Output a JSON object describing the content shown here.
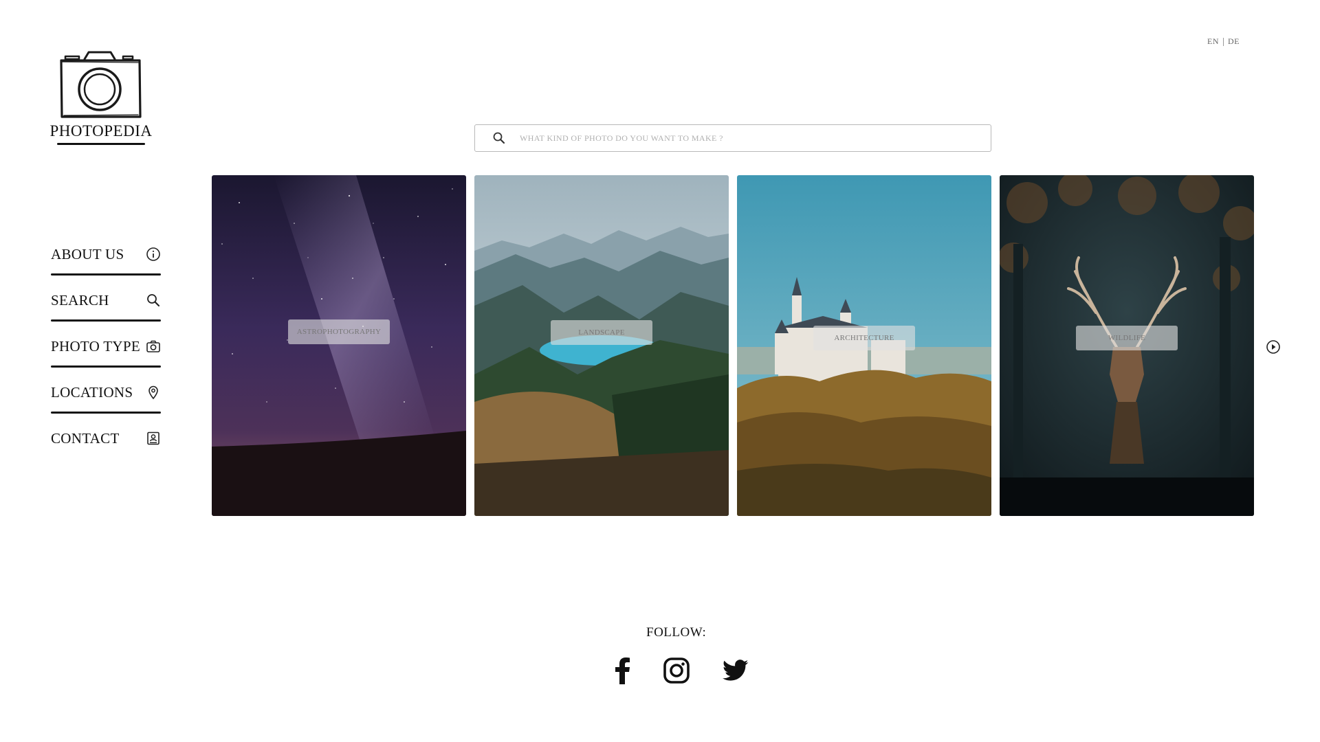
{
  "header": {
    "lang_en": "EN",
    "lang_de": "DE",
    "logo_text": "PHOTOPEDIA"
  },
  "search": {
    "placeholder": "WHAT KIND OF PHOTO DO YOU WANT TO MAKE ?"
  },
  "nav": {
    "items": [
      {
        "label": "ABOUT US",
        "icon": "info-icon"
      },
      {
        "label": "SEARCH",
        "icon": "search-icon"
      },
      {
        "label": "PHOTO TYPE",
        "icon": "camera-icon"
      },
      {
        "label": "LOCATIONS",
        "icon": "location-pin-icon"
      },
      {
        "label": "CONTACT",
        "icon": "contact-card-icon"
      }
    ]
  },
  "categories": [
    {
      "label": "ASTROPHOTOGRAPHY"
    },
    {
      "label": "LANDSCAPE"
    },
    {
      "label": "ARCHITECTURE"
    },
    {
      "label": "WILDLIFE"
    }
  ],
  "footer": {
    "follow_label": "FOLLOW:",
    "social": [
      "facebook-icon",
      "instagram-icon",
      "twitter-icon"
    ]
  }
}
